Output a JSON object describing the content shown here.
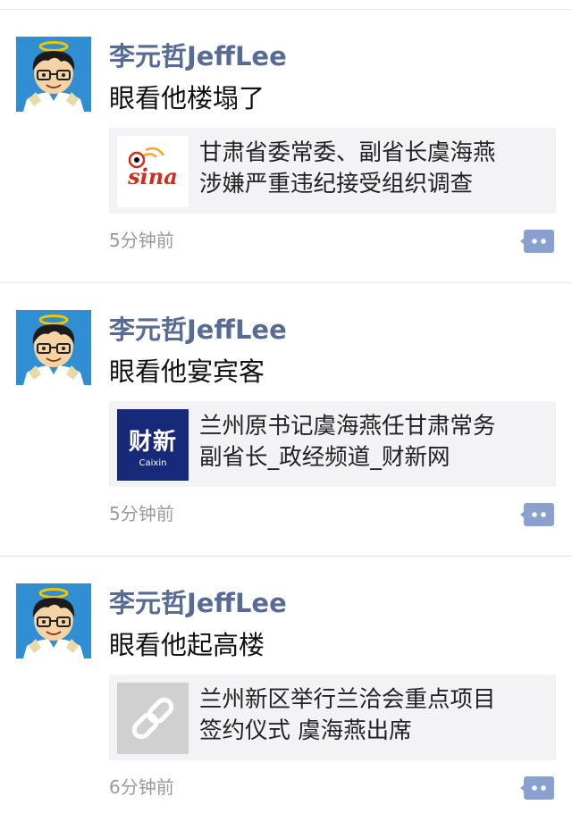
{
  "posts": [
    {
      "author": "李元哲JeffLee",
      "text": "眼看他楼塌了",
      "link": {
        "source": "sina",
        "thumb_text": "sina",
        "title": "甘肃省委常委、副省长虞海燕\n涉嫌严重违纪接受组织调查"
      },
      "time": "5分钟前"
    },
    {
      "author": "李元哲JeffLee",
      "text": "眼看他宴宾客",
      "link": {
        "source": "caixin",
        "thumb_text": "财新",
        "thumb_subtext": "Caixin",
        "title": "兰州原书记虞海燕任甘肃常务\n副省长_政经频道_财新网"
      },
      "time": "5分钟前"
    },
    {
      "author": "李元哲JeffLee",
      "text": "眼看他起高楼",
      "link": {
        "source": "generic-link",
        "title": "兰州新区举行兰洽会重点项目\n签约仪式 虞海燕出席"
      },
      "time": "6分钟前"
    }
  ],
  "colors": {
    "author_name": "#576b95",
    "card_background": "#f3f3f5",
    "more_button": "#8aa1cf",
    "avatar_background": "#2f8fd2",
    "caixin_background": "#172a79",
    "sina_red": "#d52b1e"
  },
  "icons": {
    "avatar": "cartoon-angel-avatar-icon",
    "more": "comment-more-icon",
    "link_placeholder": "chain-link-icon"
  }
}
